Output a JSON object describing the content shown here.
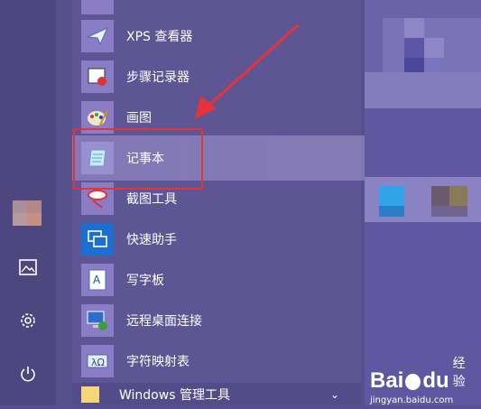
{
  "apps": [
    {
      "label": "XPS 查看器",
      "icon": "xps-viewer-icon"
    },
    {
      "label": "步骤记录器",
      "icon": "steps-recorder-icon"
    },
    {
      "label": "画图",
      "icon": "paint-icon"
    },
    {
      "label": "记事本",
      "icon": "notepad-icon"
    },
    {
      "label": "截图工具",
      "icon": "snipping-tool-icon"
    },
    {
      "label": "快速助手",
      "icon": "quick-assist-icon"
    },
    {
      "label": "写字板",
      "icon": "wordpad-icon"
    },
    {
      "label": "远程桌面连接",
      "icon": "remote-desktop-icon"
    },
    {
      "label": "字符映射表",
      "icon": "character-map-icon"
    }
  ],
  "group": {
    "label": "Windows 管理工具"
  },
  "watermark": {
    "brand": "Bai",
    "brand2": "du",
    "cn": "经验",
    "url": "jingyan.baidu.com"
  },
  "colors": {
    "highlight": "#e5333a",
    "accent": "#8a7dc5"
  }
}
